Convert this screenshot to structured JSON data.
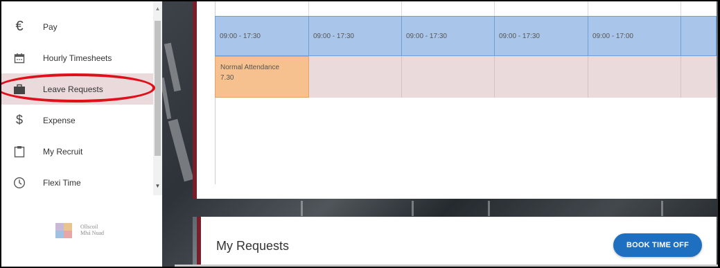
{
  "sidebar": {
    "items": [
      {
        "label": "Pay",
        "icon": "euro-icon",
        "active": false
      },
      {
        "label": "Hourly Timesheets",
        "icon": "calendar-icon",
        "active": false
      },
      {
        "label": "Leave Requests",
        "icon": "briefcase-icon",
        "active": true
      },
      {
        "label": "Expense",
        "icon": "dollar-icon",
        "active": false
      },
      {
        "label": "My Recruit",
        "icon": "clipboard-icon",
        "active": false
      },
      {
        "label": "Flexi Time",
        "icon": "clock-icon",
        "active": false
      }
    ],
    "logo": {
      "line1": "Ollscoil",
      "line2": "Mhá Nuad"
    }
  },
  "schedule": {
    "shifts": [
      "09:00 - 17:30",
      "09:00 - 17:30",
      "09:00 - 17:30",
      "09:00 - 17:30",
      "09:00 - 17:00"
    ],
    "attendance": {
      "line1": "Normal Attendance",
      "line2": "7.30"
    }
  },
  "requests": {
    "title": "My Requests",
    "book_button": "BOOK TIME OFF"
  },
  "colors": {
    "accent": "#7a1f2a",
    "shift": "#a9c6ea",
    "attendance": "#f6c18f",
    "active_nav": "#eadadb",
    "button": "#1f6fc0",
    "annotation": "#e0101a"
  }
}
